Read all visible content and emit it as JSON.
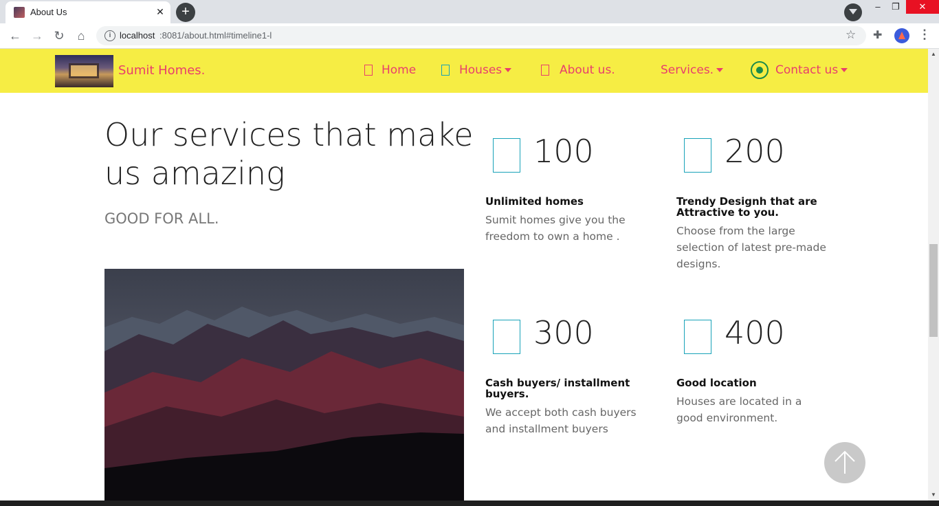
{
  "browser": {
    "tab_title": "About Us",
    "tab_close": "✕",
    "new_tab": "+",
    "url_host": "localhost",
    "url_rest": ":8081/about.html#timeline1-l",
    "window_buttons": {
      "minimize": "–",
      "maximize": "❐",
      "close": "✕"
    }
  },
  "navbar": {
    "brand": "Sumit Homes.",
    "items": [
      {
        "label": "Home"
      },
      {
        "label": "Houses"
      },
      {
        "label": "About us."
      },
      {
        "label": "Services."
      },
      {
        "label": "Contact us"
      }
    ]
  },
  "main": {
    "heading_line1": "Our services that make",
    "heading_line2": "us amazing",
    "subheading": "GOOD FOR ALL."
  },
  "services": [
    {
      "number": "100",
      "title": "Unlimited homes",
      "description": "Sumit homes give you the freedom to own a home ."
    },
    {
      "number": "200",
      "title": "Trendy Designh that are Attractive to you.",
      "description": "Choose from the large selection of latest pre-made designs."
    },
    {
      "number": "300",
      "title": "Cash buyers/ installment buyers.",
      "description": "We accept both cash buyers and installment buyers"
    },
    {
      "number": "400",
      "title": "Good location",
      "description": "Houses are located in a good environment."
    }
  ],
  "colors": {
    "navbar_bg": "#f6ed44",
    "accent": "#e83e6c",
    "box_border": "#17a2b8"
  }
}
